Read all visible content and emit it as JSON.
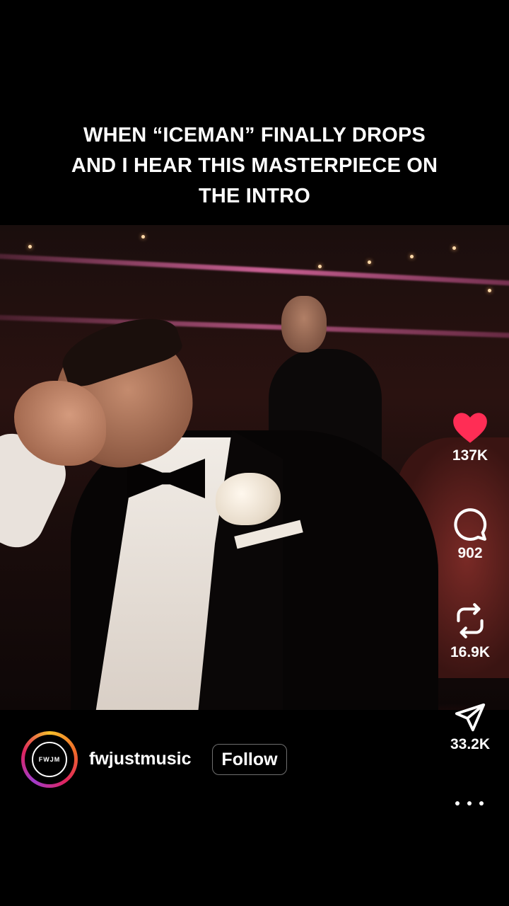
{
  "caption": {
    "line1": "WHEN “ICEMAN” FINALLY DROPS",
    "line2": "AND I HEAR THIS MASTERPIECE ON",
    "line3": "THE INTRO"
  },
  "actions": {
    "like": {
      "icon": "heart-filled-icon",
      "count": "137K",
      "color": "#ff2d55"
    },
    "comment": {
      "icon": "comment-bubble-icon",
      "count": "902"
    },
    "repost": {
      "icon": "repost-icon",
      "count": "16.9K"
    },
    "share": {
      "icon": "send-icon",
      "count": "33.2K"
    },
    "more": {
      "icon": "more-dots-icon"
    }
  },
  "author": {
    "username": "fwjustmusic",
    "avatar_text": "FWJM",
    "follow_label": "Follow"
  },
  "colors": {
    "background": "#000000",
    "text": "#ffffff",
    "like": "#ff2d55"
  }
}
